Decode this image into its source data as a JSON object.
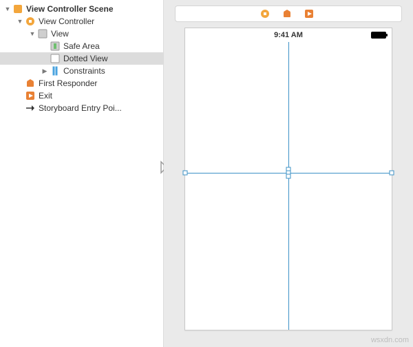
{
  "outline": {
    "scene_label": "View Controller Scene",
    "vc_label": "View Controller",
    "view_label": "View",
    "safe_area_label": "Safe Area",
    "dotted_view_label": "Dotted View",
    "constraints_label": "Constraints",
    "first_responder_label": "First Responder",
    "exit_label": "Exit",
    "storyboard_entry_label": "Storyboard Entry Poi..."
  },
  "statusbar": {
    "time": "9:41 AM"
  },
  "watermark": "wsxdn.com"
}
